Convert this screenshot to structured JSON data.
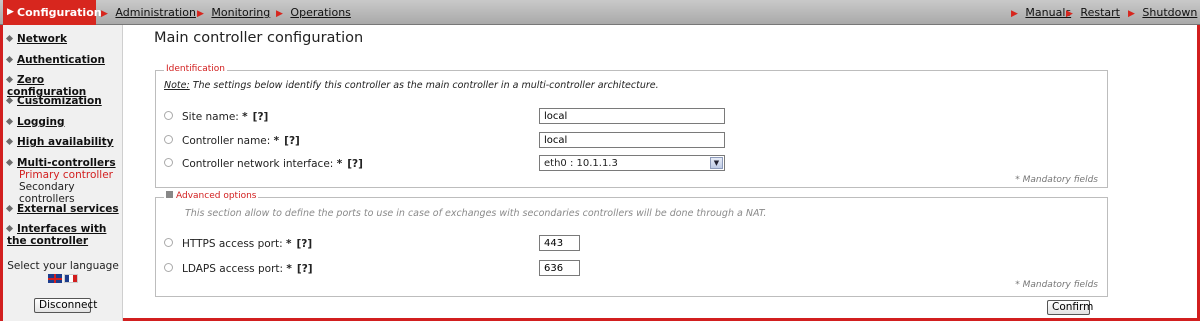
{
  "topbar": {
    "tabs": [
      {
        "label": "Configuration",
        "active": true
      },
      {
        "label": "Administration"
      },
      {
        "label": "Monitoring"
      },
      {
        "label": "Operations"
      }
    ],
    "right_links": [
      "Manuals",
      "Restart",
      "Shutdown"
    ]
  },
  "sidebar": {
    "items": [
      "Network",
      "Authentication",
      "Zero configuration",
      "Customization",
      "Logging",
      "High availability",
      "Multi-controllers",
      "External services",
      "Interfaces with the controller"
    ],
    "sub_items": [
      {
        "label": "Primary controller",
        "active": true
      },
      {
        "label": "Secondary controllers"
      }
    ],
    "language_label": "Select your language",
    "disconnect_label": "Disconnect"
  },
  "main": {
    "title": "Main controller configuration",
    "identification": {
      "legend": "Identification",
      "note_prefix": "Note:",
      "note_text": "The settings below identify this controller as the main controller in a multi-controller architecture.",
      "fields": [
        {
          "label": "Site name:",
          "value": "local"
        },
        {
          "label": "Controller name:",
          "value": "local"
        },
        {
          "label": "Controller network interface:",
          "value": "eth0 : 10.1.1.3"
        }
      ],
      "mandatory": "* Mandatory fields"
    },
    "advanced": {
      "legend": "Advanced options",
      "hint": "This section allow to define the ports to use in case of exchanges with secondaries controllers will be done through a NAT.",
      "fields": [
        {
          "label": "HTTPS access port:",
          "value": "443"
        },
        {
          "label": "LDAPS access port:",
          "value": "636"
        }
      ],
      "mandatory": "* Mandatory fields"
    },
    "required_mark": "*",
    "help_mark": "[?]",
    "confirm_label": "Confirm"
  },
  "colors": {
    "accent": "#d21f1f",
    "topbar": "#b5b5b5",
    "sidebar": "#f0f0f0"
  }
}
